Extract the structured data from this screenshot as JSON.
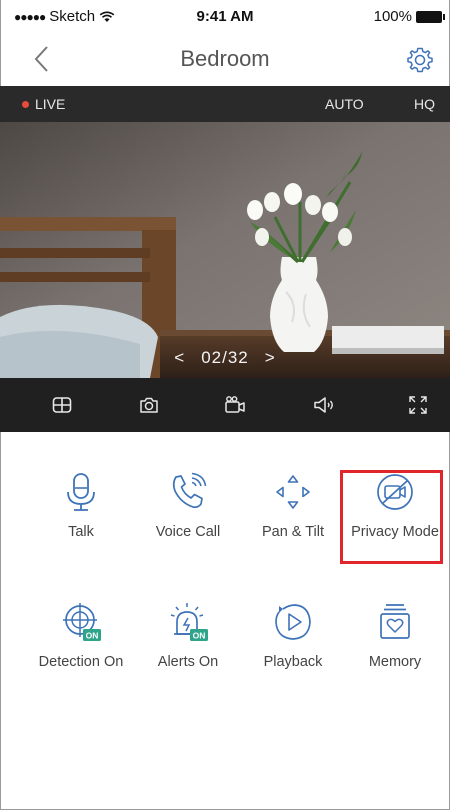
{
  "status_bar": {
    "carrier": "Sketch",
    "time": "9:41 AM",
    "battery": "100%"
  },
  "nav": {
    "title": "Bedroom",
    "back_icon": "chevron-left-icon",
    "settings_icon": "gear-icon"
  },
  "live_bar": {
    "live_label": "LIVE",
    "auto_label": "AUTO",
    "quality_label": "HQ",
    "live_color": "#e84a3c"
  },
  "video": {
    "pager_prev": "<",
    "pager_text": "02/32",
    "pager_next": ">"
  },
  "controls": [
    {
      "name": "layout-grid-icon"
    },
    {
      "name": "camera-snapshot-icon"
    },
    {
      "name": "video-record-icon"
    },
    {
      "name": "volume-icon"
    },
    {
      "name": "fullscreen-icon"
    }
  ],
  "actions": [
    {
      "label": "Talk",
      "icon": "microphone-icon"
    },
    {
      "label": "Voice Call",
      "icon": "phone-call-icon"
    },
    {
      "label": "Pan & Tilt",
      "icon": "pan-tilt-arrows-icon"
    },
    {
      "label": "Privacy Mode",
      "icon": "privacy-camera-off-icon"
    },
    {
      "label": "Detection On",
      "icon": "detection-target-icon",
      "badge": "ON"
    },
    {
      "label": "Alerts On",
      "icon": "alert-bell-icon",
      "badge": "ON"
    },
    {
      "label": "Playback",
      "icon": "playback-icon"
    },
    {
      "label": "Memory",
      "icon": "memory-card-icon"
    }
  ],
  "accent_color": "#3f73b8",
  "badge_color": "#2ea58a",
  "highlight_color": "#e0252b"
}
